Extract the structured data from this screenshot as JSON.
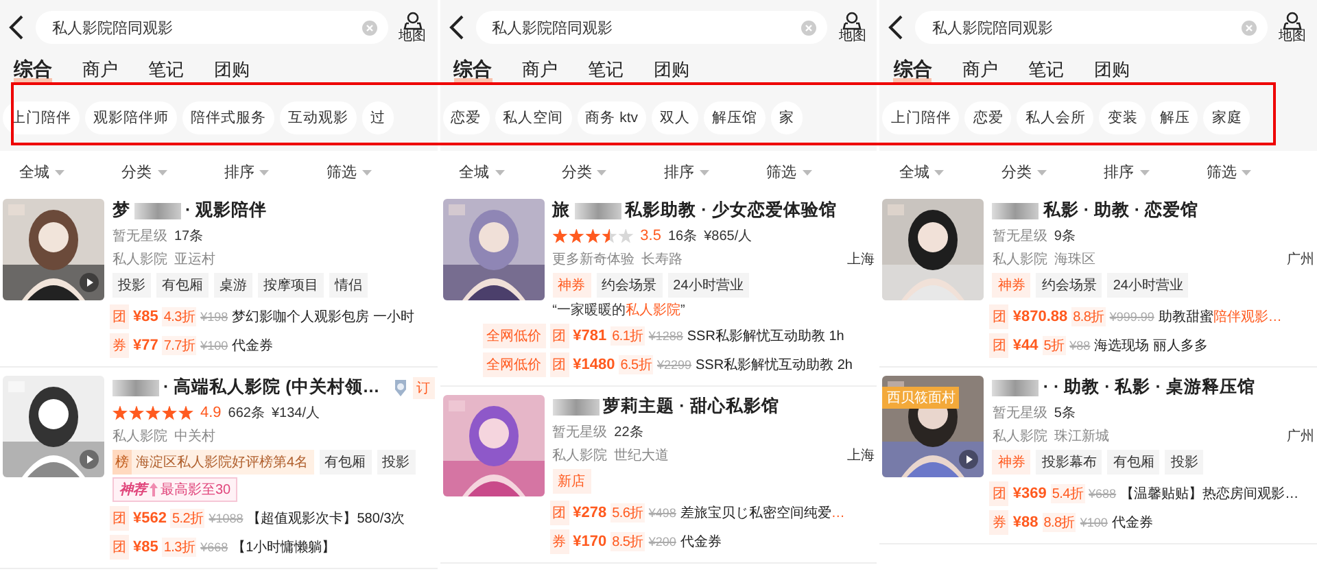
{
  "panels": [
    {
      "search": {
        "value": "私人影院陪同观影"
      },
      "map_label": "地图",
      "tabs": [
        {
          "label": "综合",
          "selected": true
        },
        {
          "label": "商户",
          "selected": false
        },
        {
          "label": "笔记",
          "selected": false
        },
        {
          "label": "团购",
          "selected": false
        }
      ],
      "chips": [
        "上门陪伴",
        "观影陪伴师",
        "陪伴式服务",
        "互动观影",
        "过"
      ],
      "filters": [
        "全城",
        "分类",
        "排序",
        "筛选"
      ],
      "listings": [
        {
          "video": true,
          "name_start": "梦",
          "name_end": "· 观影陪伴",
          "rating_text": "暂无星级",
          "reviews": "17条",
          "category": "私人影院",
          "area": "亚运村",
          "tags": [
            {
              "kind": "plain",
              "text": "投影"
            },
            {
              "kind": "plain",
              "text": "有包厢"
            },
            {
              "kind": "plain",
              "text": "桌游"
            },
            {
              "kind": "plain",
              "text": "按摩项目"
            },
            {
              "kind": "plain",
              "text": "情侣"
            }
          ],
          "deals": [
            {
              "badge": "团",
              "price": "¥85",
              "discount": "4.3折",
              "original": "¥198",
              "title": "梦幻影咖个人观影包房 一小时"
            },
            {
              "badge": "券",
              "price": "¥77",
              "discount": "7.7折",
              "original": "¥100",
              "title": "代金券"
            }
          ]
        },
        {
          "video": true,
          "name_end": "· 高端私人影院 (中关村领…",
          "medal": true,
          "reserve": "订",
          "stars": 5,
          "score": "4.9",
          "reviews": "662条",
          "avg_price": "¥134/人",
          "category": "私人影院",
          "area": "中关村",
          "tags": [
            {
              "kind": "rank",
              "icon": "榜",
              "text": "海淀区私人影院好评榜第4名"
            },
            {
              "kind": "plain",
              "text": "有包厢"
            },
            {
              "kind": "plain",
              "text": "投影"
            }
          ],
          "boost": {
            "logo": "神荐",
            "text": "最高影至30"
          },
          "deals": [
            {
              "badge": "团",
              "price": "¥562",
              "discount": "5.2折",
              "original": "¥1088",
              "title": "【超值观影次卡】580/3次"
            },
            {
              "badge": "团",
              "price": "¥85",
              "discount": "1.3折",
              "original": "¥668",
              "title": "【1小时慵懒躺】"
            }
          ]
        }
      ]
    },
    {
      "search": {
        "value": "私人影院陪同观影"
      },
      "map_label": "地图",
      "tabs": [
        {
          "label": "综合",
          "selected": true
        },
        {
          "label": "商户",
          "selected": false
        },
        {
          "label": "笔记",
          "selected": false
        },
        {
          "label": "团购",
          "selected": false
        }
      ],
      "chips": [
        "恋爱",
        "私人空间",
        "商务 ktv",
        "双人",
        "解压馆",
        "家"
      ],
      "filters": [
        "全城",
        "分类",
        "排序",
        "筛选"
      ],
      "listings": [
        {
          "video": false,
          "name_start": "旅",
          "name_end": "私影助教 · 少女恋爱体验馆",
          "stars": 3.5,
          "score": "3.5",
          "reviews": "16条",
          "avg_price": "¥865/人",
          "category": "更多新奇体验",
          "area": "长寿路",
          "city": "上海",
          "tags": [
            {
              "kind": "coupon",
              "text": "神券"
            },
            {
              "kind": "plain",
              "text": "约会场景"
            },
            {
              "kind": "plain",
              "text": "24小时营业"
            }
          ],
          "quote": {
            "before": "“一家暖暖的",
            "accent": "私人影院",
            "after": "”"
          },
          "deals": [
            {
              "lowest": "全网低价",
              "badge": "团",
              "price": "¥781",
              "discount": "6.1折",
              "original": "¥1288",
              "title": "SSR私影解忧互动助教 1h"
            },
            {
              "lowest": "全网低价",
              "badge": "团",
              "price": "¥1480",
              "discount": "6.5折",
              "original": "¥2299",
              "title": "SSR私影解忧互动助教 2h"
            }
          ]
        },
        {
          "video": false,
          "name_end": "萝莉主题 · 甜心私影馆",
          "rating_text": "暂无星级",
          "reviews": "22条",
          "category": "私人影院",
          "area": "世纪大道",
          "city": "上海",
          "tags": [
            {
              "kind": "new",
              "text": "新店"
            }
          ],
          "deals": [
            {
              "badge": "团",
              "price": "¥278",
              "discount": "5.6折",
              "original": "¥498",
              "title": "差旅宝贝じ私密空间纯爱",
              "title_accent": "…"
            },
            {
              "badge": "券",
              "price": "¥170",
              "discount": "8.5折",
              "original": "¥200",
              "title": "代金券"
            }
          ]
        }
      ]
    },
    {
      "search": {
        "value": "私人影院陪同观影"
      },
      "map_label": "地图",
      "tabs": [
        {
          "label": "综合",
          "selected": true
        },
        {
          "label": "商户",
          "selected": false
        },
        {
          "label": "笔记",
          "selected": false
        },
        {
          "label": "团购",
          "selected": false
        }
      ],
      "chips": [
        "上门陪伴",
        "恋爱",
        "私人会所",
        "变装",
        "解压",
        "家庭"
      ],
      "filters": [
        "全城",
        "分类",
        "排序",
        "筛选"
      ],
      "listings": [
        {
          "video": false,
          "name_end": "私影 · 助教 · 恋爱馆",
          "rating_text": "暂无星级",
          "reviews": "9条",
          "category": "私人影院",
          "area": "海珠区",
          "city": "广州",
          "tags": [
            {
              "kind": "coupon",
              "text": "神券"
            },
            {
              "kind": "plain",
              "text": "约会场景"
            },
            {
              "kind": "plain",
              "text": "24小时营业"
            }
          ],
          "deals": [
            {
              "badge": "团",
              "price": "¥870.88",
              "discount": "8.8折",
              "original": "¥999.99",
              "title": "助教甜蜜",
              "title_accent": "陪伴观影…"
            },
            {
              "badge": "团",
              "price": "¥44",
              "discount": "5折",
              "original": "¥88",
              "title": "海选现场 丽人多多"
            }
          ]
        },
        {
          "video": true,
          "image_badge": "西贝筱面村",
          "name_end": "· · 助教 · 私影 · 桌游释压馆",
          "rating_text": "暂无星级",
          "reviews": "5条",
          "category": "私人影院",
          "area": "珠江新城",
          "city": "广州",
          "tags": [
            {
              "kind": "coupon",
              "text": "神券"
            },
            {
              "kind": "plain",
              "text": "投影幕布"
            },
            {
              "kind": "plain",
              "text": "有包厢"
            },
            {
              "kind": "plain",
              "text": "投影"
            }
          ],
          "deals": [
            {
              "badge": "团",
              "price": "¥369",
              "discount": "5.4折",
              "original": "¥688",
              "title": "【温馨贴贴】热恋房间观影…"
            },
            {
              "badge": "券",
              "price": "¥88",
              "discount": "8.8折",
              "original": "¥100",
              "title": "代金券"
            }
          ]
        }
      ]
    }
  ]
}
